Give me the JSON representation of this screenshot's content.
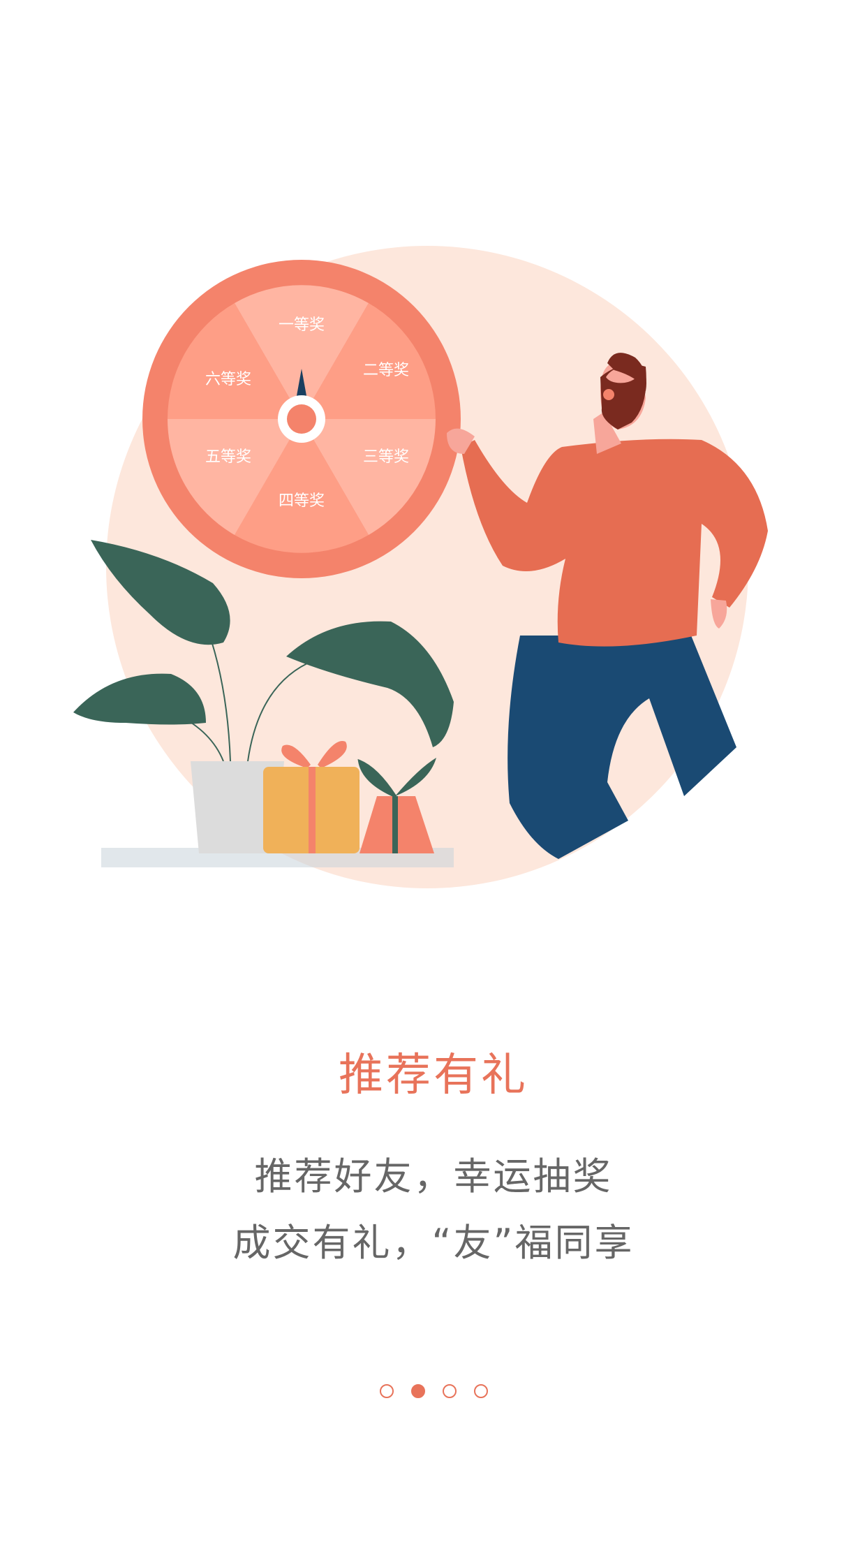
{
  "page": {
    "title": "推荐有礼",
    "subtitle_line1": "推荐好友，幸运抽奖",
    "subtitle_line2": "成交有礼，“友”福同享"
  },
  "wheel": {
    "prizes": [
      "一等奖",
      "二等奖",
      "三等奖",
      "四等奖",
      "五等奖",
      "六等奖"
    ]
  },
  "pager": {
    "total": 4,
    "current_index": 1
  },
  "colors": {
    "accent": "#e8735a",
    "circle_bg": "#fde7dc",
    "wheel_rim": "#f4836b",
    "leaf": "#3a6558",
    "pants": "#1a4a73",
    "sweater": "#e66d52",
    "gift_yellow": "#f0b159",
    "pot": "#dcdcdc"
  },
  "icons": {
    "illustration": "prize-wheel-illustration"
  }
}
